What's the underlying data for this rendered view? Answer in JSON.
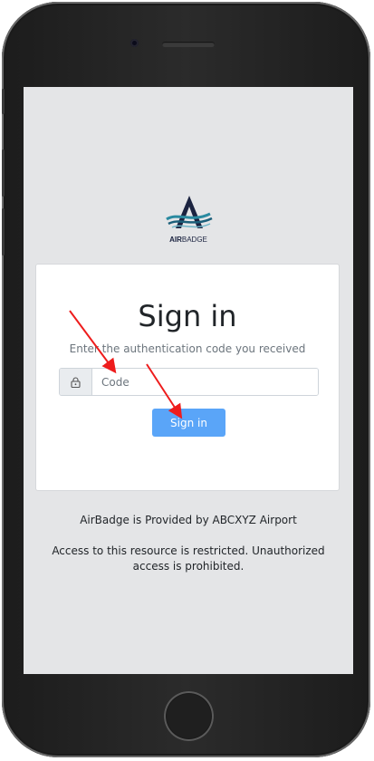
{
  "logo": {
    "text_bold": "AIR",
    "text_regular": "BADGE",
    "colors": {
      "navy": "#1b2340",
      "teal": "#2a8aa0"
    }
  },
  "signin": {
    "title": "Sign in",
    "subtitle": "Enter the authentication code you received",
    "code_placeholder": "Code",
    "code_value": "",
    "button_label": "Sign in",
    "button_color": "#5aa5f8",
    "lock_icon": "lock-icon"
  },
  "footer": {
    "provided_by": "AirBadge is Provided by ABCXYZ Airport",
    "warning": "Access to this resource is restricted. Unauthorized access is prohibited."
  },
  "annotations": {
    "arrow_color": "#ee1c1c"
  }
}
